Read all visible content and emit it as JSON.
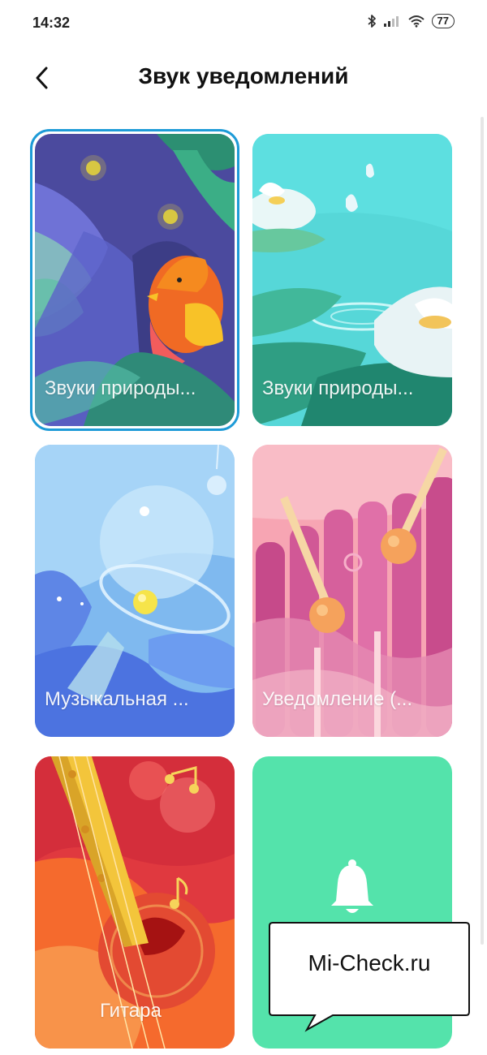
{
  "status_bar": {
    "time": "14:32",
    "battery": "77"
  },
  "header": {
    "title": "Звук уведомлений",
    "back_icon": "chevron-left-icon"
  },
  "cards": [
    {
      "label": "Звуки природы...",
      "selected": true
    },
    {
      "label": "Звуки природы..."
    },
    {
      "label": "Музыкальная ..."
    },
    {
      "label": "Уведомление (..."
    },
    {
      "label": "Гитара"
    },
    {
      "label": "",
      "icon": "bell-icon"
    }
  ],
  "watermark": {
    "text": "Mi-Check.ru"
  },
  "colors": {
    "accent": "#1e9bd7",
    "default_card": "#54e3ab"
  }
}
